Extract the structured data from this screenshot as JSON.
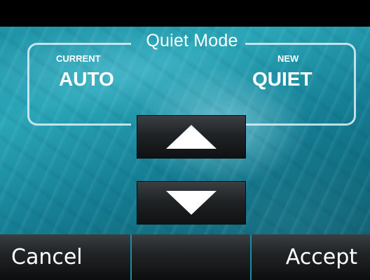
{
  "screen": {
    "title": "Quiet Mode",
    "current": {
      "label": "CURRENT",
      "value": "AUTO"
    },
    "new": {
      "label": "NEW",
      "value": "QUIET"
    }
  },
  "controls": {
    "up_icon": "up-arrow-icon",
    "down_icon": "down-arrow-icon"
  },
  "bottom_bar": {
    "cancel_label": "Cancel",
    "middle_label": "",
    "accept_label": "Accept"
  },
  "colors": {
    "background_teal": "#1b8da1",
    "divider": "#1c8ea3",
    "text": "#ffffff"
  }
}
